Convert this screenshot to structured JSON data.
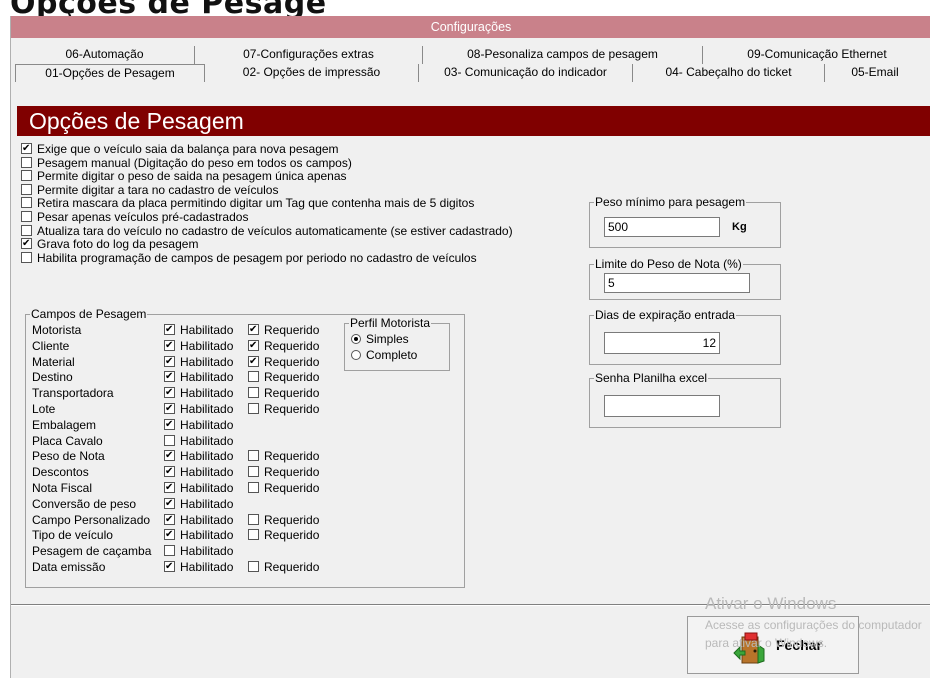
{
  "page_heading": "Opções de Pesage",
  "window_title": "Configurações",
  "tabs_back": [
    {
      "label": "06-Automação"
    },
    {
      "label": "07-Configurações extras"
    },
    {
      "label": "08-Pesonaliza campos de pesagem"
    },
    {
      "label": "09-Comunicação Ethernet"
    }
  ],
  "tabs_front": [
    {
      "label": "01-Opções de Pesagem",
      "active": true
    },
    {
      "label": "02- Opções de impressão"
    },
    {
      "label": "03- Comunicação do indicador"
    },
    {
      "label": "04- Cabeçalho do ticket"
    },
    {
      "label": "05-Email"
    }
  ],
  "section_title": "Opções de Pesagem",
  "options": [
    {
      "label": "Exige que o veículo saia da balança para nova pesagem",
      "checked": true
    },
    {
      "label": "Pesagem manual (Digitação do peso em todos os campos)",
      "checked": false
    },
    {
      "label": "Permite digitar o peso de saida na pesagem única apenas",
      "checked": false
    },
    {
      "label": "Permite digitar a tara no cadastro de veículos",
      "checked": false
    },
    {
      "label": "Retira mascara da placa permitindo digitar um Tag que contenha mais de 5 digitos",
      "checked": false
    },
    {
      "label": "Pesar apenas veículos pré-cadastrados",
      "checked": false
    },
    {
      "label": "Atualiza tara do veículo no cadastro de veículos automaticamente (se estiver cadastrado)",
      "checked": false
    },
    {
      "label": "Grava foto do log da pesagem",
      "checked": true
    },
    {
      "label": "Habilita programação de campos de pesagem por periodo no cadastro de veículos",
      "checked": false
    }
  ],
  "campos": {
    "title": "Campos de Pesagem",
    "hab_label": "Habilitado",
    "req_label": "Requerido",
    "fields": [
      {
        "name": "Motorista",
        "hab": true,
        "req": true,
        "show_req": true
      },
      {
        "name": "Cliente",
        "hab": true,
        "req": true,
        "show_req": true
      },
      {
        "name": "Material",
        "hab": true,
        "req": true,
        "show_req": true
      },
      {
        "name": "Destino",
        "hab": true,
        "req": false,
        "show_req": true
      },
      {
        "name": "Transportadora",
        "hab": true,
        "req": false,
        "show_req": true
      },
      {
        "name": "Lote",
        "hab": true,
        "req": false,
        "show_req": true
      },
      {
        "name": "Embalagem",
        "hab": true,
        "req": false,
        "show_req": false
      },
      {
        "name": "Placa Cavalo",
        "hab": false,
        "req": false,
        "show_req": false
      },
      {
        "name": "Peso de Nota",
        "hab": true,
        "req": false,
        "show_req": true
      },
      {
        "name": "Descontos",
        "hab": true,
        "req": false,
        "show_req": true
      },
      {
        "name": "Nota Fiscal",
        "hab": true,
        "req": false,
        "show_req": true
      },
      {
        "name": "Conversão de peso",
        "hab": true,
        "req": false,
        "show_req": false
      },
      {
        "name": "Campo Personalizado",
        "hab": true,
        "req": false,
        "show_req": true
      },
      {
        "name": "Tipo de veículo",
        "hab": true,
        "req": false,
        "show_req": true
      },
      {
        "name": "Pesagem de caçamba",
        "hab": false,
        "req": false,
        "show_req": false
      },
      {
        "name": "Data emissão",
        "hab": true,
        "req": false,
        "show_req": true
      }
    ]
  },
  "perfil": {
    "title": "Perfil Motorista",
    "options": [
      {
        "label": "Simples",
        "selected": true
      },
      {
        "label": "Completo",
        "selected": false
      }
    ]
  },
  "peso_minimo": {
    "title": "Peso mínimo para pesagem",
    "value": "500",
    "unit": "Kg"
  },
  "limite_nota": {
    "title": "Limite do Peso de Nota (%)",
    "value": "5"
  },
  "dias_expiracao": {
    "title": "Dias de expiração entrada",
    "value": "12"
  },
  "senha_planilha": {
    "title": "Senha Planilha excel",
    "value": ""
  },
  "close_button": {
    "label": "Fechar"
  },
  "watermark": {
    "title": "Ativar o Windows",
    "line": "Acesse as configurações do computador para ativar o Windows."
  }
}
